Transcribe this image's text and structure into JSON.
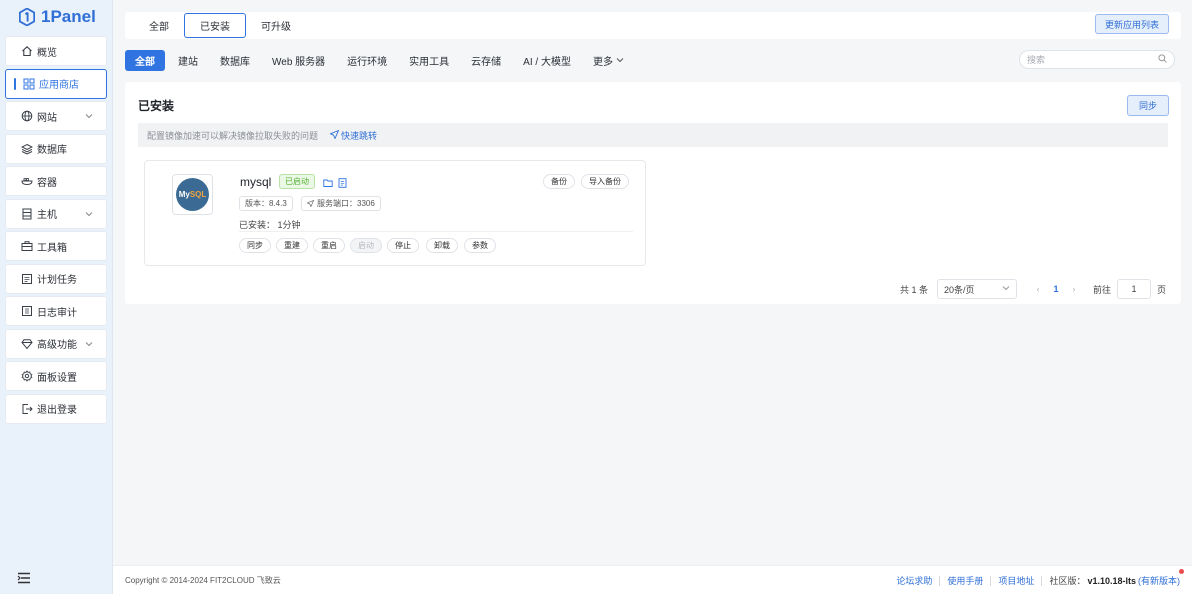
{
  "logo": {
    "text": "1Panel"
  },
  "sidebar": {
    "items": [
      {
        "label": "概览",
        "icon": "home-icon",
        "expandable": false,
        "active": false
      },
      {
        "label": "应用商店",
        "icon": "grid-icon",
        "expandable": false,
        "active": true
      },
      {
        "label": "网站",
        "icon": "globe-icon",
        "expandable": true,
        "active": false
      },
      {
        "label": "数据库",
        "icon": "database-icon",
        "expandable": false,
        "active": false
      },
      {
        "label": "容器",
        "icon": "container-icon",
        "expandable": false,
        "active": false
      },
      {
        "label": "主机",
        "icon": "server-icon",
        "expandable": true,
        "active": false
      },
      {
        "label": "工具箱",
        "icon": "toolbox-icon",
        "expandable": false,
        "active": false
      },
      {
        "label": "计划任务",
        "icon": "calendar-icon",
        "expandable": false,
        "active": false
      },
      {
        "label": "日志审计",
        "icon": "log-icon",
        "expandable": false,
        "active": false
      },
      {
        "label": "高级功能",
        "icon": "diamond-icon",
        "expandable": true,
        "active": false
      },
      {
        "label": "面板设置",
        "icon": "gear-icon",
        "expandable": false,
        "active": false
      },
      {
        "label": "退出登录",
        "icon": "logout-icon",
        "expandable": false,
        "active": false
      }
    ]
  },
  "top_tabs": [
    "全部",
    "已安装",
    "可升级"
  ],
  "top_tab_active": "已安装",
  "update_button": "更新应用列表",
  "categories": [
    "全部",
    "建站",
    "数据库",
    "Web 服务器",
    "运行环境",
    "实用工具",
    "云存储",
    "AI / 大模型",
    "更多"
  ],
  "category_active": "全部",
  "search": {
    "placeholder": "搜索"
  },
  "main": {
    "title": "已安装",
    "sync_button": "同步",
    "tip": {
      "text": "配置镜像加速可以解决镜像拉取失败的问题",
      "link": "快速跳转"
    }
  },
  "app": {
    "name": "mysql",
    "logo_text_a": "My",
    "logo_text_b": "SQL",
    "status": "已启动",
    "backup": "备份",
    "import_backup": "导入备份",
    "version": "版本：8.4.3",
    "port": "服务端口：3306",
    "installed": "已安装：  1分钟",
    "actions": [
      {
        "label": "同步",
        "disabled": false
      },
      {
        "label": "重建",
        "disabled": false
      },
      {
        "label": "重启",
        "disabled": false
      },
      {
        "label": "启动",
        "disabled": true
      },
      {
        "label": "停止",
        "disabled": false
      },
      {
        "label": "卸载",
        "disabled": false
      },
      {
        "label": "参数",
        "disabled": false
      }
    ]
  },
  "pagination": {
    "total": "共 1 条",
    "page_size": "20条/页",
    "current": "1",
    "goto_label": "前往",
    "goto_value": "1",
    "page_suffix": "页"
  },
  "footer": {
    "copyright": "Copyright © 2014-2024 FIT2CLOUD 飞致云",
    "links": [
      "论坛求助",
      "使用手册",
      "项目地址"
    ],
    "edition_label": "社区版：",
    "version": "v1.10.18-lts",
    "new_version": "(有新版本)"
  },
  "colors": {
    "accent": "#2f74e0",
    "success": "#52b030",
    "sidebar_bg": "#e9f1fb"
  }
}
